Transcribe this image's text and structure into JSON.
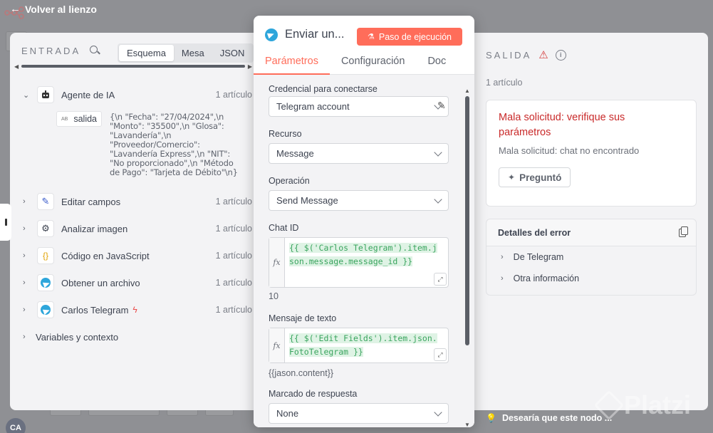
{
  "topbar": {
    "back_label": "Volver al lienzo"
  },
  "input": {
    "title": "ENTRADA",
    "tabs": [
      "Esquema",
      "Mesa",
      "JSON"
    ],
    "nodes": [
      {
        "label": "Agente de IA",
        "count": "1 artículo",
        "icon": "robot-icon",
        "expanded": true
      },
      {
        "label": "Editar campos",
        "count": "1 artículo",
        "icon": "pencil-icon"
      },
      {
        "label": "Analizar imagen",
        "count": "1 artículo",
        "icon": "openai-icon"
      },
      {
        "label": "Código en JavaScript",
        "count": "1 artículo",
        "icon": "code-braces-icon"
      },
      {
        "label": "Obtener un archivo",
        "count": "1 artículo",
        "icon": "telegram-icon"
      },
      {
        "label": "Carlos Telegram",
        "count": "1 artículo",
        "icon": "telegram-icon"
      }
    ],
    "sub_field": {
      "tag": "AB",
      "name": "salida"
    },
    "sub_json": "{\\n  \"Fecha\": \"27/04/2024\",\\n  \"Monto\": \"35500\",\\n  \"Glosa\": \"Lavandería\",\\n  \"Proveedor/Comercio\": \"Lavandería Express\",\\n  \"NIT\": \"No proporcionado\",\\n  \"Método de Pago\": \"Tarjeta de Débito\"\\n}",
    "vars_label": "Variables y contexto"
  },
  "modal": {
    "title": "Enviar un...",
    "exec_button": "Paso de ejecución",
    "tabs": [
      "Parámetros",
      "Configuración",
      "Doc"
    ],
    "credential_label": "Credencial para conectarse",
    "credential_value": "Telegram account",
    "resource_label": "Recurso",
    "resource_value": "Message",
    "operation_label": "Operación",
    "operation_value": "Send Message",
    "chat_id_label": "Chat ID",
    "chat_id_expr": "{{ $('Carlos Telegram').item.json.message.message_id }}",
    "chat_id_result": "10",
    "text_label": "Mensaje de texto",
    "text_expr": "{{ $('Edit Fields').item.json.FotoTelegram }}",
    "text_result": "{{jason.content}}",
    "markup_label": "Marcado de respuesta",
    "markup_value": "None",
    "fx_label": "fx"
  },
  "output": {
    "title": "SALIDA",
    "count": "1 artículo",
    "error_title": "Mala solicitud: verifique sus parámetros",
    "error_message": "Mala solicitud: chat no encontrado",
    "ask_button": "Preguntó",
    "details_title": "Detalles del error",
    "details_rows": [
      "De Telegram",
      "Otra información"
    ]
  },
  "footer_hint": "Desearía que este nodo ...",
  "watermark": "Platzi",
  "avatar": "CA",
  "colors": {
    "accent": "#ff6d5a",
    "error": "#c92a2a",
    "expr_green": "#3ba55f",
    "telegram": "#2ea6db"
  }
}
